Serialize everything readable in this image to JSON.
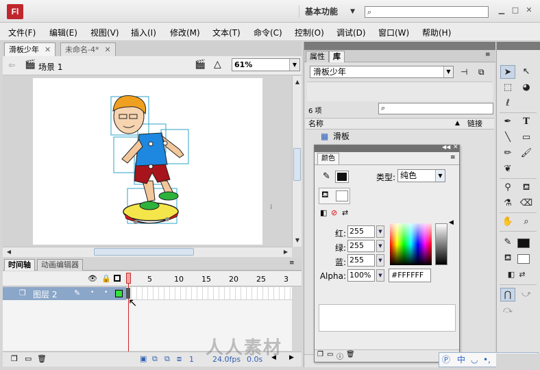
{
  "app": {
    "logo": "Fl"
  },
  "titlebar": {
    "workspace": "基本功能",
    "search_placeholder": ""
  },
  "menu": [
    "文件(F)",
    "编辑(E)",
    "视图(V)",
    "插入(I)",
    "修改(M)",
    "文本(T)",
    "命令(C)",
    "控制(O)",
    "调试(D)",
    "窗口(W)",
    "帮助(H)"
  ],
  "doc_tabs": [
    {
      "label": "滑板少年",
      "active": true
    },
    {
      "label": "未命名-4*",
      "active": false
    }
  ],
  "scene": {
    "label": "场景 1",
    "zoom": "61%"
  },
  "timeline": {
    "tabs": [
      "时间轴",
      "动画编辑器"
    ],
    "frame_numbers": [
      "1",
      "5",
      "10",
      "15",
      "20",
      "25",
      "3"
    ],
    "layer_name": "图层 2",
    "footer": {
      "current_frame": "1",
      "fps": "24.0fps",
      "elapsed": "0.0s"
    }
  },
  "library": {
    "tabs": [
      "属性",
      "库"
    ],
    "document": "滑板少年",
    "count": "6 项",
    "col_name": "名称",
    "col_link": "链接",
    "items": [
      "滑板"
    ]
  },
  "color_panel": {
    "tab": "颜色",
    "type_label": "类型:",
    "type_value": "纯色",
    "red_label": "红:",
    "red": "255",
    "green_label": "绿:",
    "green": "255",
    "blue_label": "蓝:",
    "blue": "255",
    "alpha_label": "Alpha:",
    "alpha": "100%",
    "hex": "#FFFFFF",
    "stroke_color": "#111111",
    "fill_color": "#ffffff"
  },
  "ime": {
    "lang": "中"
  },
  "colors": {
    "accent": "#c0272d",
    "layer_selected": "#8aa6c8"
  }
}
